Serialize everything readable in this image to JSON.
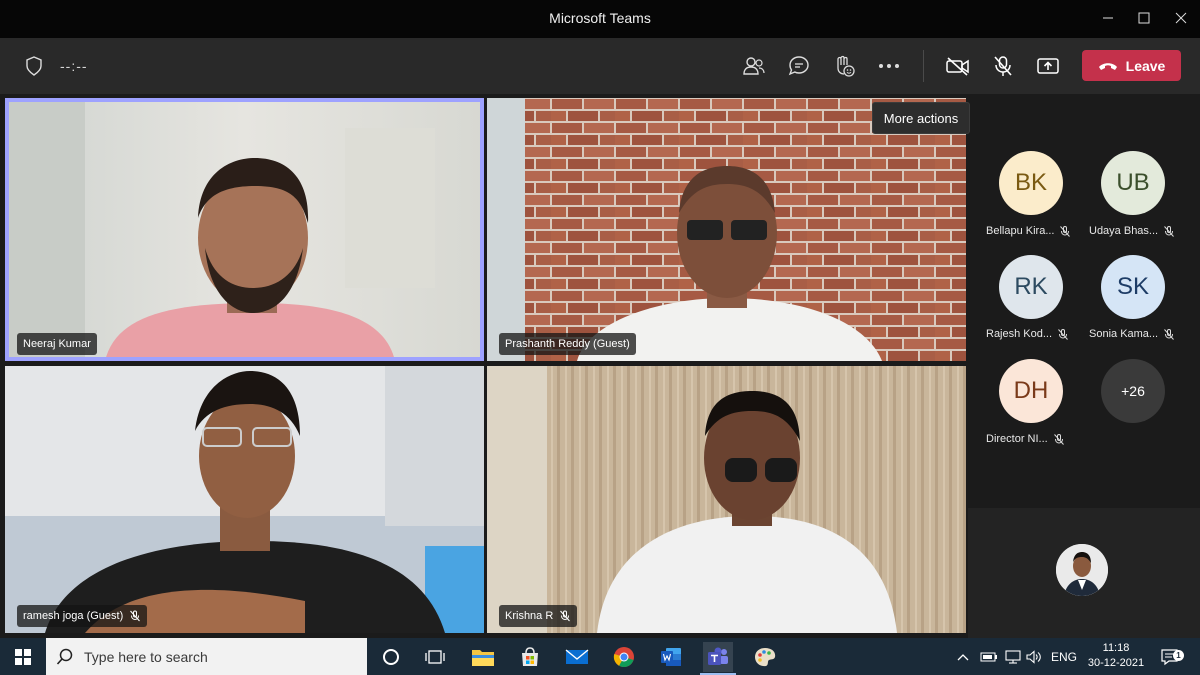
{
  "window": {
    "title": "Microsoft Teams"
  },
  "toolbar": {
    "timer": "--:--",
    "leave_label": "Leave",
    "icons": [
      "shield-icon",
      "people-icon",
      "chat-icon",
      "raise-hand-icon",
      "more-icon",
      "camera-off-icon",
      "mic-off-icon",
      "share-icon"
    ]
  },
  "tooltip": {
    "text": "More actions"
  },
  "tiles": [
    {
      "name": "Neeraj Kumar",
      "muted": false
    },
    {
      "name": "Prashanth Reddy (Guest)",
      "muted": false
    },
    {
      "name": "ramesh joga (Guest)",
      "muted": true
    },
    {
      "name": "Krishna R",
      "muted": true
    }
  ],
  "participants": [
    {
      "initials": "BK",
      "name": "Bellapu Kira...",
      "bg": "#fbeccb",
      "fg": "#7a5a12"
    },
    {
      "initials": "UB",
      "name": "Udaya Bhas...",
      "bg": "#e3eadb",
      "fg": "#3b4f2c"
    },
    {
      "initials": "RK",
      "name": "Rajesh Kod...",
      "bg": "#dfe6ec",
      "fg": "#2c4a60"
    },
    {
      "initials": "SK",
      "name": "Sonia Kama...",
      "bg": "#d5e5f6",
      "fg": "#1d3c66"
    },
    {
      "initials": "DH",
      "name": "Director NI...",
      "bg": "#fbe6d8",
      "fg": "#7a3a1a"
    }
  ],
  "overflow": {
    "label": "+26"
  },
  "taskbar": {
    "search_placeholder": "Type here to search",
    "lang": "ENG",
    "time": "11:18",
    "date": "30-12-2021",
    "notification_count": "1"
  },
  "colors": {
    "accent": "#9ea2ff",
    "leave": "#c4314b"
  }
}
